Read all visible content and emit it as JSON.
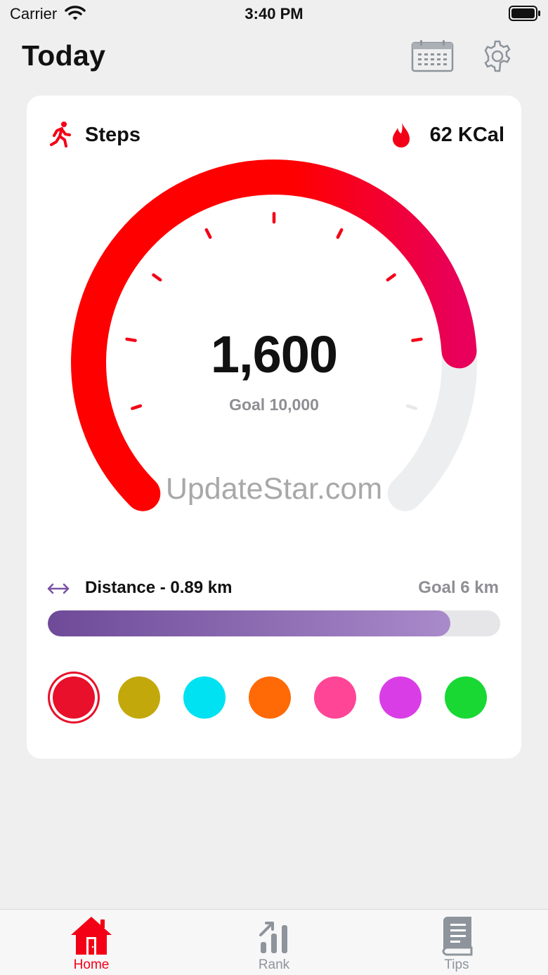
{
  "status_bar": {
    "carrier": "Carrier",
    "time": "3:40 PM"
  },
  "header": {
    "title": "Today",
    "calendar_icon": "calendar-icon",
    "settings_icon": "gear-icon"
  },
  "card": {
    "steps_label": "Steps",
    "steps_icon": "walking-person-icon",
    "calories": "62 KCal",
    "calories_icon": "flame-icon",
    "step_count": "1,600",
    "goal": "Goal 10,000",
    "gauge_progress": 0.82,
    "watermark": "UpdateStar.com",
    "distance_label": "Distance - 0.89 km",
    "distance_goal": "Goal 6 km",
    "distance_progress": 0.89
  },
  "colors": {
    "accent": "#f40016",
    "gauge_start": "#ff0000",
    "gauge_end": "#e8005a",
    "gauge_track": "#eceef0",
    "purple": "#7a52a6"
  },
  "swatches": [
    {
      "name": "red",
      "color": "#e8102a",
      "selected": true
    },
    {
      "name": "olive",
      "color": "#c3a80c",
      "selected": false
    },
    {
      "name": "cyan",
      "color": "#00e1f2",
      "selected": false
    },
    {
      "name": "orange",
      "color": "#ff6a06",
      "selected": false
    },
    {
      "name": "pink",
      "color": "#ff4596",
      "selected": false
    },
    {
      "name": "magenta",
      "color": "#d93ee6",
      "selected": false
    },
    {
      "name": "green",
      "color": "#19d834",
      "selected": false
    }
  ],
  "tabs": [
    {
      "label": "Home",
      "icon": "house-icon",
      "active": true
    },
    {
      "label": "Rank",
      "icon": "bar-chart-icon",
      "active": false
    },
    {
      "label": "Tips",
      "icon": "book-icon",
      "active": false
    }
  ]
}
